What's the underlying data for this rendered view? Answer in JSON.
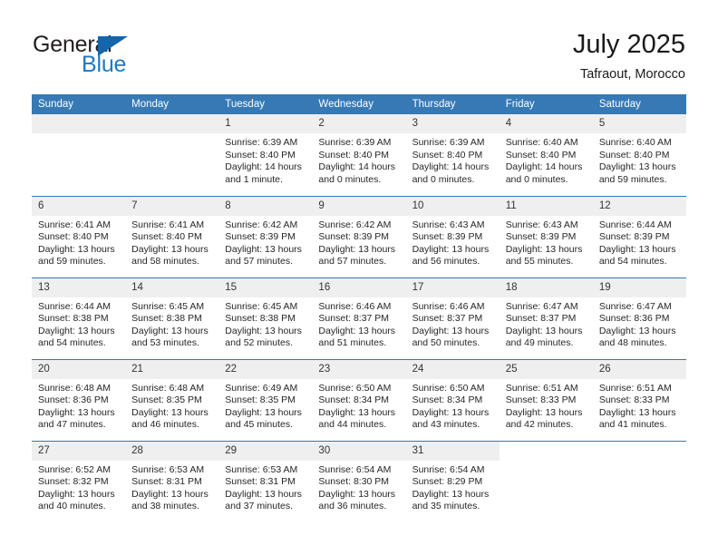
{
  "brand": {
    "name_top": "General",
    "name_bottom": "Blue",
    "color_text": "#231f20",
    "color_blue": "#1f77c4",
    "triangle_color": "#1166ae"
  },
  "header": {
    "title": "July 2025",
    "subtitle": "Tafraout, Morocco",
    "header_bg": "#3679b5",
    "daynum_bg": "#efefef"
  },
  "weekdays": [
    "Sunday",
    "Monday",
    "Tuesday",
    "Wednesday",
    "Thursday",
    "Friday",
    "Saturday"
  ],
  "weeks": [
    [
      {
        "day": "",
        "sunrise": "",
        "sunset": "",
        "daylight": "",
        "empty": true
      },
      {
        "day": "",
        "sunrise": "",
        "sunset": "",
        "daylight": "",
        "empty": true
      },
      {
        "day": "1",
        "sunrise": "Sunrise: 6:39 AM",
        "sunset": "Sunset: 8:40 PM",
        "daylight": "Daylight: 14 hours and 1 minute."
      },
      {
        "day": "2",
        "sunrise": "Sunrise: 6:39 AM",
        "sunset": "Sunset: 8:40 PM",
        "daylight": "Daylight: 14 hours and 0 minutes."
      },
      {
        "day": "3",
        "sunrise": "Sunrise: 6:39 AM",
        "sunset": "Sunset: 8:40 PM",
        "daylight": "Daylight: 14 hours and 0 minutes."
      },
      {
        "day": "4",
        "sunrise": "Sunrise: 6:40 AM",
        "sunset": "Sunset: 8:40 PM",
        "daylight": "Daylight: 14 hours and 0 minutes."
      },
      {
        "day": "5",
        "sunrise": "Sunrise: 6:40 AM",
        "sunset": "Sunset: 8:40 PM",
        "daylight": "Daylight: 13 hours and 59 minutes."
      }
    ],
    [
      {
        "day": "6",
        "sunrise": "Sunrise: 6:41 AM",
        "sunset": "Sunset: 8:40 PM",
        "daylight": "Daylight: 13 hours and 59 minutes."
      },
      {
        "day": "7",
        "sunrise": "Sunrise: 6:41 AM",
        "sunset": "Sunset: 8:40 PM",
        "daylight": "Daylight: 13 hours and 58 minutes."
      },
      {
        "day": "8",
        "sunrise": "Sunrise: 6:42 AM",
        "sunset": "Sunset: 8:39 PM",
        "daylight": "Daylight: 13 hours and 57 minutes."
      },
      {
        "day": "9",
        "sunrise": "Sunrise: 6:42 AM",
        "sunset": "Sunset: 8:39 PM",
        "daylight": "Daylight: 13 hours and 57 minutes."
      },
      {
        "day": "10",
        "sunrise": "Sunrise: 6:43 AM",
        "sunset": "Sunset: 8:39 PM",
        "daylight": "Daylight: 13 hours and 56 minutes."
      },
      {
        "day": "11",
        "sunrise": "Sunrise: 6:43 AM",
        "sunset": "Sunset: 8:39 PM",
        "daylight": "Daylight: 13 hours and 55 minutes."
      },
      {
        "day": "12",
        "sunrise": "Sunrise: 6:44 AM",
        "sunset": "Sunset: 8:39 PM",
        "daylight": "Daylight: 13 hours and 54 minutes."
      }
    ],
    [
      {
        "day": "13",
        "sunrise": "Sunrise: 6:44 AM",
        "sunset": "Sunset: 8:38 PM",
        "daylight": "Daylight: 13 hours and 54 minutes."
      },
      {
        "day": "14",
        "sunrise": "Sunrise: 6:45 AM",
        "sunset": "Sunset: 8:38 PM",
        "daylight": "Daylight: 13 hours and 53 minutes."
      },
      {
        "day": "15",
        "sunrise": "Sunrise: 6:45 AM",
        "sunset": "Sunset: 8:38 PM",
        "daylight": "Daylight: 13 hours and 52 minutes."
      },
      {
        "day": "16",
        "sunrise": "Sunrise: 6:46 AM",
        "sunset": "Sunset: 8:37 PM",
        "daylight": "Daylight: 13 hours and 51 minutes."
      },
      {
        "day": "17",
        "sunrise": "Sunrise: 6:46 AM",
        "sunset": "Sunset: 8:37 PM",
        "daylight": "Daylight: 13 hours and 50 minutes."
      },
      {
        "day": "18",
        "sunrise": "Sunrise: 6:47 AM",
        "sunset": "Sunset: 8:37 PM",
        "daylight": "Daylight: 13 hours and 49 minutes."
      },
      {
        "day": "19",
        "sunrise": "Sunrise: 6:47 AM",
        "sunset": "Sunset: 8:36 PM",
        "daylight": "Daylight: 13 hours and 48 minutes."
      }
    ],
    [
      {
        "day": "20",
        "sunrise": "Sunrise: 6:48 AM",
        "sunset": "Sunset: 8:36 PM",
        "daylight": "Daylight: 13 hours and 47 minutes."
      },
      {
        "day": "21",
        "sunrise": "Sunrise: 6:48 AM",
        "sunset": "Sunset: 8:35 PM",
        "daylight": "Daylight: 13 hours and 46 minutes."
      },
      {
        "day": "22",
        "sunrise": "Sunrise: 6:49 AM",
        "sunset": "Sunset: 8:35 PM",
        "daylight": "Daylight: 13 hours and 45 minutes."
      },
      {
        "day": "23",
        "sunrise": "Sunrise: 6:50 AM",
        "sunset": "Sunset: 8:34 PM",
        "daylight": "Daylight: 13 hours and 44 minutes."
      },
      {
        "day": "24",
        "sunrise": "Sunrise: 6:50 AM",
        "sunset": "Sunset: 8:34 PM",
        "daylight": "Daylight: 13 hours and 43 minutes."
      },
      {
        "day": "25",
        "sunrise": "Sunrise: 6:51 AM",
        "sunset": "Sunset: 8:33 PM",
        "daylight": "Daylight: 13 hours and 42 minutes."
      },
      {
        "day": "26",
        "sunrise": "Sunrise: 6:51 AM",
        "sunset": "Sunset: 8:33 PM",
        "daylight": "Daylight: 13 hours and 41 minutes."
      }
    ],
    [
      {
        "day": "27",
        "sunrise": "Sunrise: 6:52 AM",
        "sunset": "Sunset: 8:32 PM",
        "daylight": "Daylight: 13 hours and 40 minutes."
      },
      {
        "day": "28",
        "sunrise": "Sunrise: 6:53 AM",
        "sunset": "Sunset: 8:31 PM",
        "daylight": "Daylight: 13 hours and 38 minutes."
      },
      {
        "day": "29",
        "sunrise": "Sunrise: 6:53 AM",
        "sunset": "Sunset: 8:31 PM",
        "daylight": "Daylight: 13 hours and 37 minutes."
      },
      {
        "day": "30",
        "sunrise": "Sunrise: 6:54 AM",
        "sunset": "Sunset: 8:30 PM",
        "daylight": "Daylight: 13 hours and 36 minutes."
      },
      {
        "day": "31",
        "sunrise": "Sunrise: 6:54 AM",
        "sunset": "Sunset: 8:29 PM",
        "daylight": "Daylight: 13 hours and 35 minutes."
      },
      {
        "day": "",
        "sunrise": "",
        "sunset": "",
        "daylight": "",
        "empty": true,
        "blank": true
      },
      {
        "day": "",
        "sunrise": "",
        "sunset": "",
        "daylight": "",
        "empty": true,
        "blank": true
      }
    ]
  ]
}
